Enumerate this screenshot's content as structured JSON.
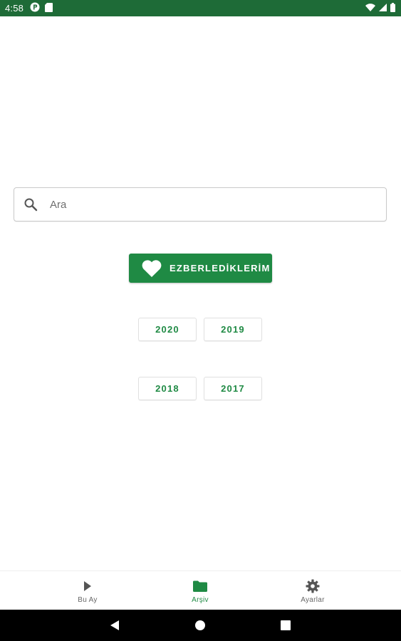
{
  "status_bar": {
    "time": "4:58",
    "icons": [
      "app-notification-icon",
      "sd-card-icon",
      "wifi-icon",
      "signal-icon",
      "battery-icon"
    ]
  },
  "search": {
    "placeholder": "Ara",
    "value": ""
  },
  "favorites_button": {
    "label": "EZBERLEDİKLERİM",
    "icon": "heart-icon"
  },
  "years": [
    "2020",
    "2019",
    "2018",
    "2017"
  ],
  "bottom_nav": {
    "items": [
      {
        "label": "Bu Ay",
        "icon": "play-icon",
        "active": false
      },
      {
        "label": "Arşiv",
        "icon": "folder-icon",
        "active": true
      },
      {
        "label": "Ayarlar",
        "icon": "gear-icon",
        "active": false
      }
    ]
  },
  "system_nav": [
    "back-icon",
    "home-icon",
    "recents-icon"
  ],
  "colors": {
    "primary": "#1f8a44",
    "status_bar": "#1e6b37",
    "nav_inactive": "#666666"
  }
}
